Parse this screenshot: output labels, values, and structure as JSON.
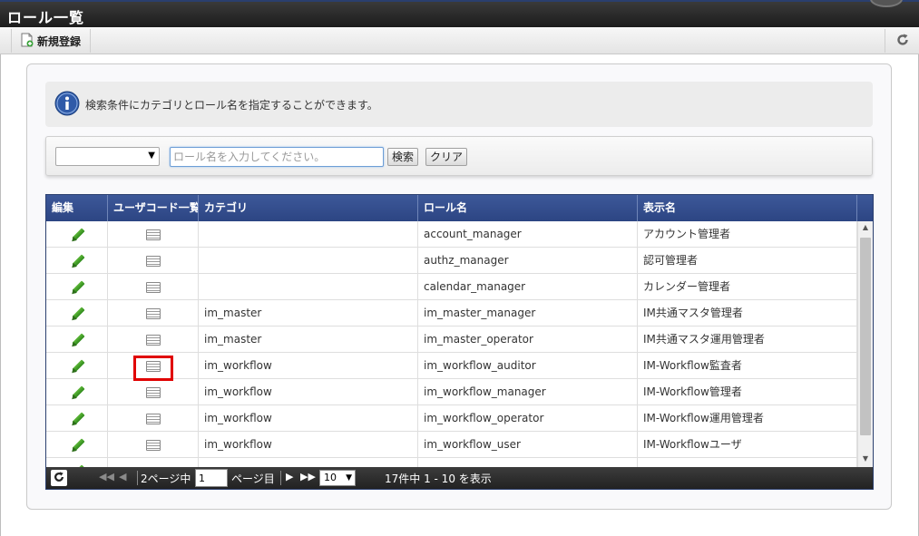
{
  "window": {
    "title": "ロール一覧"
  },
  "toolbar": {
    "new_label": "新規登録",
    "new_icon": "new-document-icon",
    "refresh_icon": "refresh-icon"
  },
  "info": {
    "icon": "info-icon",
    "message": "検索条件にカテゴリとロール名を指定することができます。"
  },
  "search": {
    "category_value": "",
    "role_placeholder": "ロール名を入力してください。",
    "search_label": "検索",
    "clear_label": "クリア"
  },
  "grid": {
    "columns": [
      "編集",
      "ユーザコード一覧",
      "カテゴリ",
      "ロール名",
      "表示名"
    ],
    "rows": [
      {
        "category": "",
        "role": "account_manager",
        "display": "アカウント管理者"
      },
      {
        "category": "",
        "role": "authz_manager",
        "display": "認可管理者"
      },
      {
        "category": "",
        "role": "calendar_manager",
        "display": "カレンダー管理者"
      },
      {
        "category": "im_master",
        "role": "im_master_manager",
        "display": "IM共通マスタ管理者"
      },
      {
        "category": "im_master",
        "role": "im_master_operator",
        "display": "IM共通マスタ運用管理者"
      },
      {
        "category": "im_workflow",
        "role": "im_workflow_auditor",
        "display": "IM-Workflow監査者"
      },
      {
        "category": "im_workflow",
        "role": "im_workflow_manager",
        "display": "IM-Workflow管理者"
      },
      {
        "category": "im_workflow",
        "role": "im_workflow_operator",
        "display": "IM-Workflow運用管理者"
      },
      {
        "category": "im_workflow",
        "role": "im_workflow_user",
        "display": "IM-Workflowユーザ"
      }
    ],
    "edit_icon": "pencil-icon",
    "list_icon": "list-icon",
    "highlight_color": "#e00000"
  },
  "pager": {
    "total_pages_label": "2ページ中",
    "page_value": "1",
    "page_suffix": "ページ目",
    "rows_per_page": "10",
    "count_label": "17件中 1 - 10 を表示"
  },
  "colors": {
    "header": "#2c4583",
    "pager": "#2a2a2a",
    "accent_input": "#6d9ed6"
  }
}
